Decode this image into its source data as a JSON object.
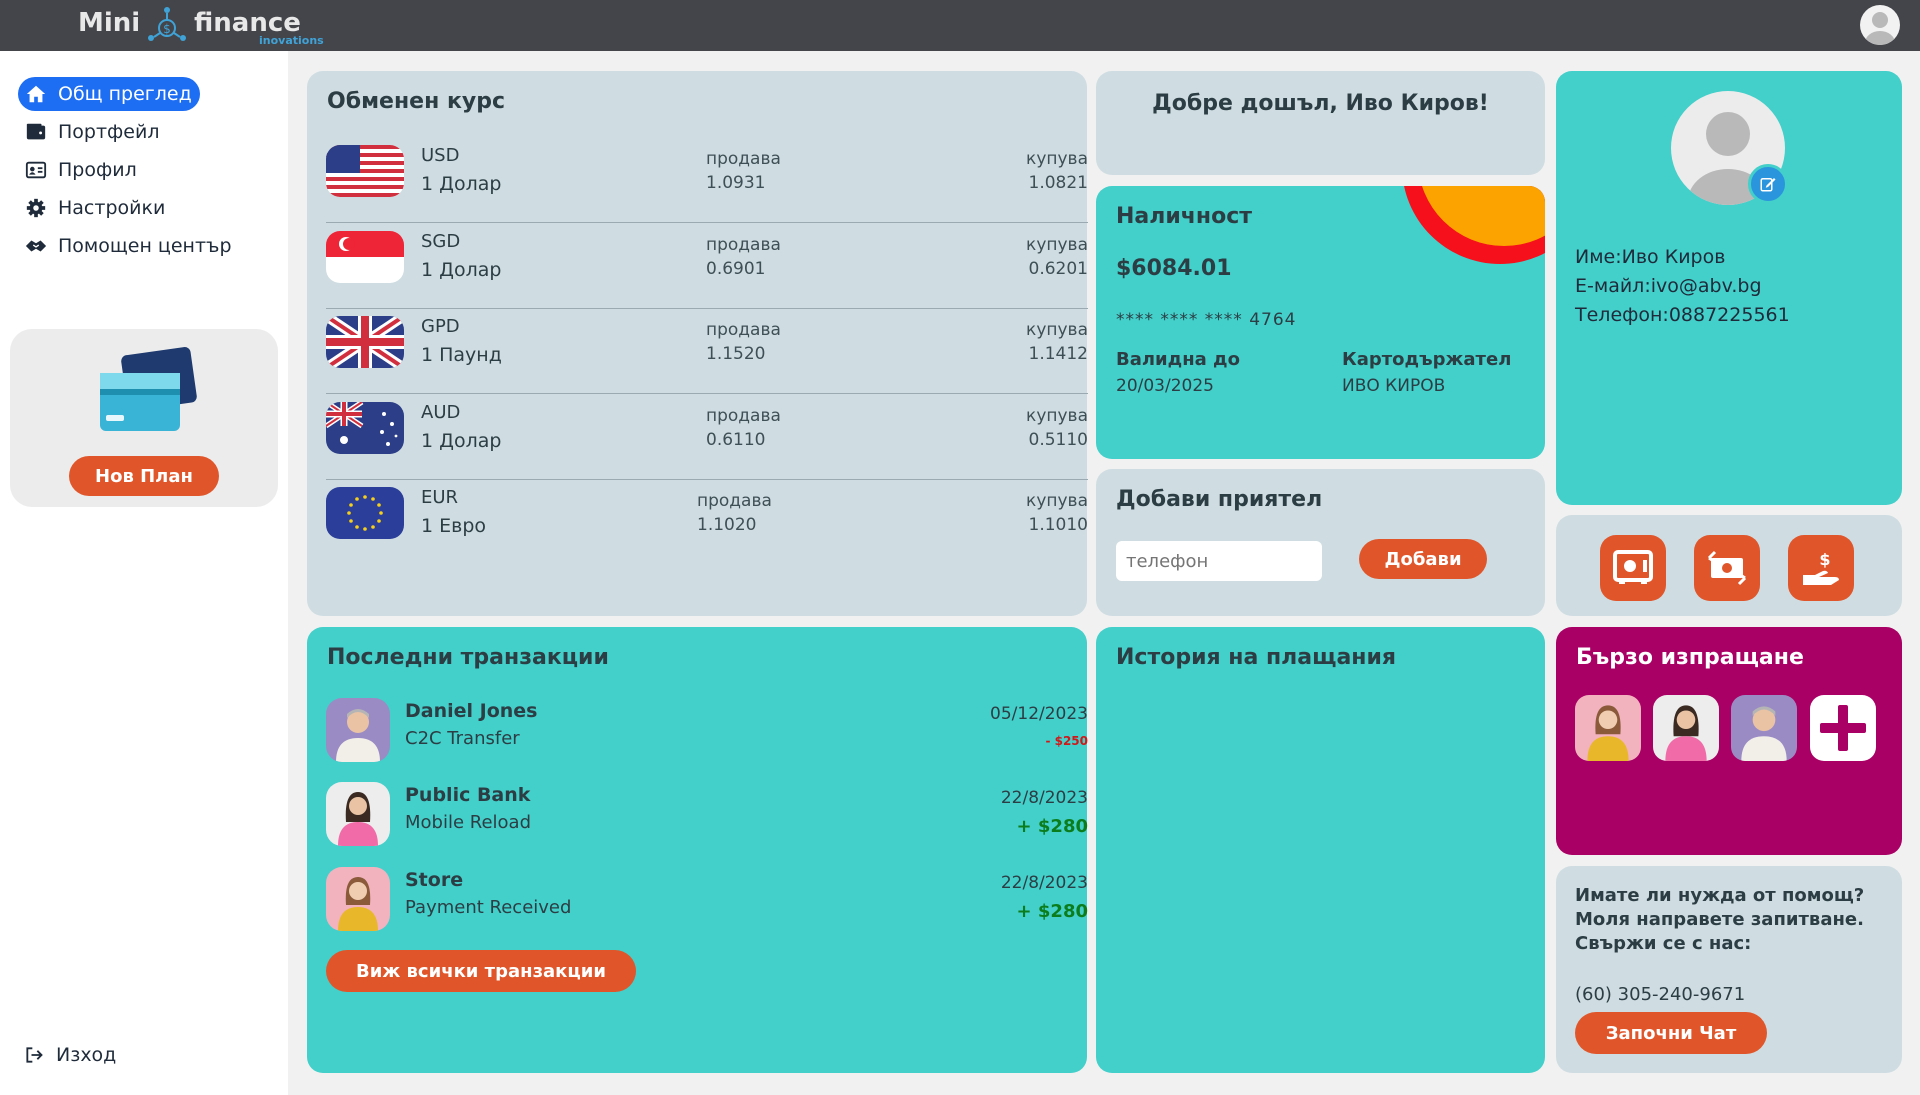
{
  "brand": {
    "name_part1": "Mini",
    "name_part2": "finance",
    "sub": "inovations"
  },
  "sidebar": {
    "items": [
      {
        "label": "Общ преглед",
        "icon": "home-icon"
      },
      {
        "label": "Портфейл",
        "icon": "wallet-icon"
      },
      {
        "label": "Профил",
        "icon": "id-card-icon"
      },
      {
        "label": "Настройки",
        "icon": "gear-icon"
      },
      {
        "label": "Помощен център",
        "icon": "handshake-icon"
      }
    ],
    "plan_button": "Нов План",
    "logout": "Изход"
  },
  "exchange": {
    "title": "Обменен курс",
    "sell_label": "продава",
    "buy_label": "купува",
    "rates": [
      {
        "code": "USD",
        "name": "1 Долар",
        "sell": "1.0931",
        "buy": "1.0821"
      },
      {
        "code": "SGD",
        "name": "1 Долар",
        "sell": "0.6901",
        "buy": "0.6201"
      },
      {
        "code": "GPD",
        "name": "1 Паунд",
        "sell": "1.1520",
        "buy": "1.1412"
      },
      {
        "code": "AUD",
        "name": "1 Долар",
        "sell": "0.6110",
        "buy": "0.5110"
      },
      {
        "code": "EUR",
        "name": "1 Евро",
        "sell": "1.1020",
        "buy": "1.1010"
      }
    ]
  },
  "welcome": {
    "text": "Добре дошъл, Иво Киров!"
  },
  "balance": {
    "title": "Наличност",
    "amount": "$6084.01",
    "card_number": "****  ****  ****  4764",
    "valid_label": "Валидна до",
    "valid_value": "20/03/2025",
    "holder_label": "Картодържател",
    "holder_value": "ИВО КИРОВ"
  },
  "add_friend": {
    "title": "Добави приятел",
    "placeholder": "телефон",
    "button": "Добави"
  },
  "profile": {
    "name": "Име:Иво Киров",
    "email": "Е-майл:ivo@abv.bg",
    "phone": "Телефон:0887225561"
  },
  "actions": [
    "safe-icon",
    "money-exchange-icon",
    "hand-dollar-icon"
  ],
  "transactions": {
    "title": "Последни транзакции",
    "items": [
      {
        "name": "Daniel Jones",
        "desc": "C2C Transfer",
        "date": "05/12/2023",
        "amount": "-  $250",
        "type": "neg"
      },
      {
        "name": "Public Bank",
        "desc": "Mobile Reload",
        "date": "22/8/2023",
        "amount": "+ $280",
        "type": "pos"
      },
      {
        "name": "Store",
        "desc": "Payment Received",
        "date": "22/8/2023",
        "amount": "+ $280",
        "type": "pos"
      }
    ],
    "all_button": "Виж всички транзакции"
  },
  "history": {
    "title": "История на плащания"
  },
  "quick_send": {
    "title": "Бързо изпращане"
  },
  "help": {
    "text": "Имате ли нужда от помощ? Моля направете запитване.",
    "contact": "Свържи се с нас:",
    "phone": "(60) 305-240-9671",
    "button": "Започни Чат"
  },
  "colors": {
    "teal": "#43cfca",
    "gray_card": "#cfdde2",
    "accent": "#e0562a",
    "magenta": "#a80064",
    "active_nav": "#1d6ef2",
    "topbar": "#44454a"
  }
}
